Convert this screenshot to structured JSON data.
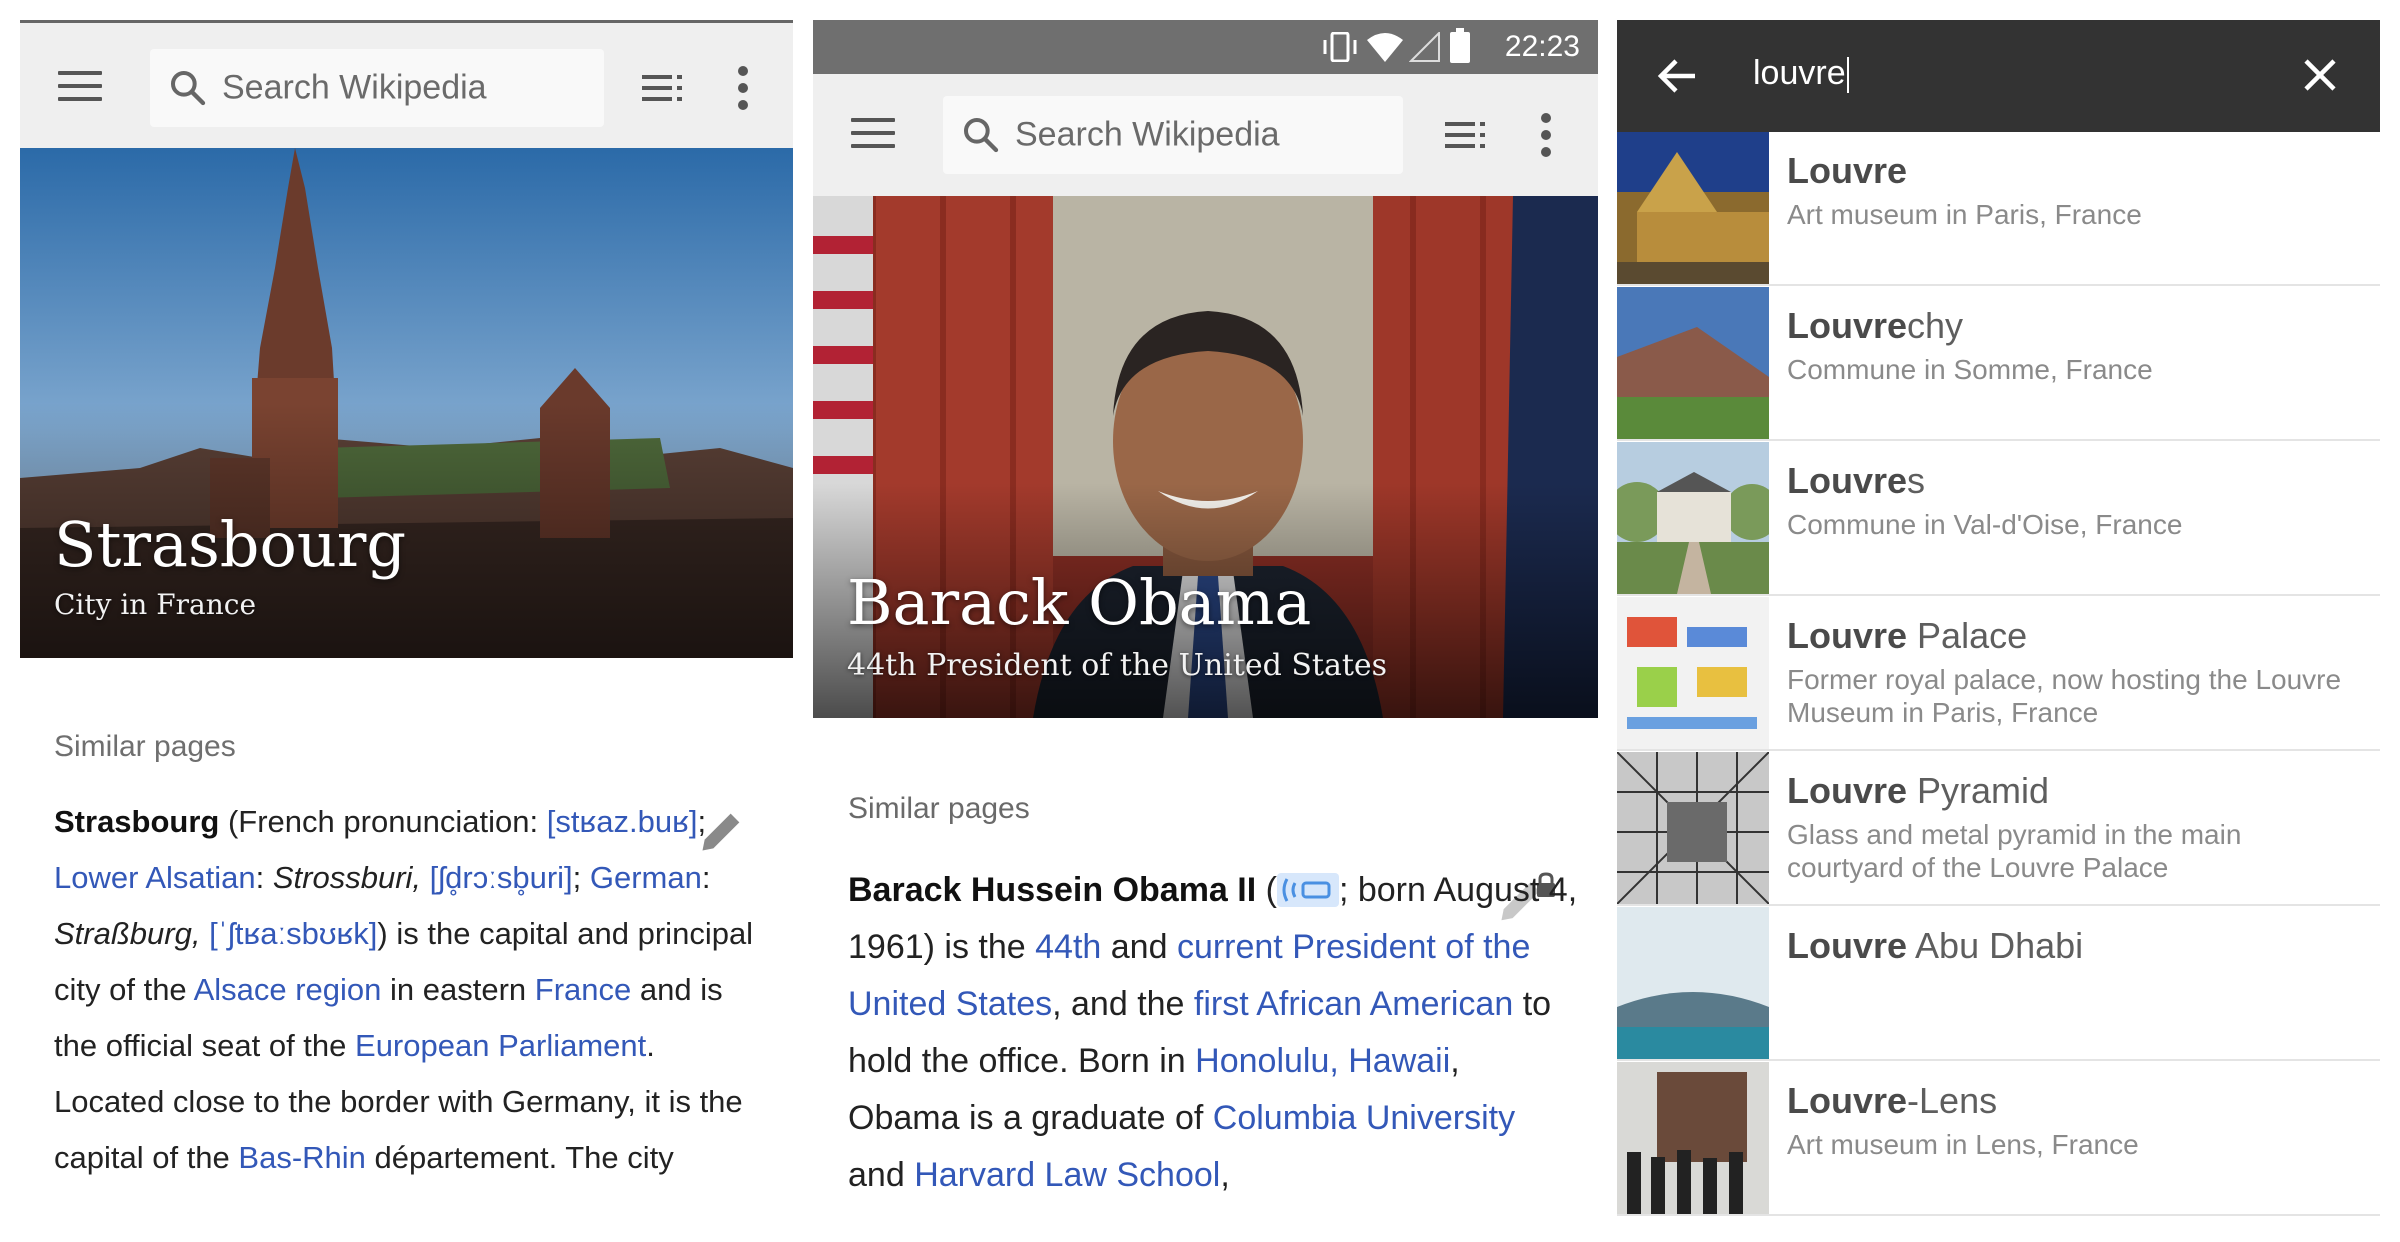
{
  "panel1": {
    "search_placeholder": "Search Wikipedia",
    "hero_title": "Strasbourg",
    "hero_subtitle": "City in France",
    "similar_pages": "Similar pages",
    "article": {
      "t1": "Strasbourg",
      "t2": " (French pronunciation: ",
      "t3": "[stʁaz.buʁ]",
      "t4": "; ",
      "t5": "Lower Alsatian",
      "t6": ": ",
      "t7": "Strossburi,",
      "t8": " ",
      "t9": "[ʃd̥rɔːsb̥uri]",
      "t10": "; ",
      "t11": "German",
      "t12": ": ",
      "t13": "Straßburg,",
      "t14": " ",
      "t15": "[ˈʃtʁaːsbʊʁk]",
      "t16": ") is the capital and principal city of the ",
      "t17": "Alsace region",
      "t18": " in eastern ",
      "t19": "France",
      "t20": " and is the official seat of the ",
      "t21": "European Parliament",
      "t22": ". Located close to the border with Germany, it is the capital of the ",
      "t23": "Bas-Rhin",
      "t24": " département. The city"
    }
  },
  "panel2": {
    "status_time": "22:23",
    "search_placeholder": "Search Wikipedia",
    "hero_title": "Barack Obama",
    "hero_subtitle": "44th President of the United States",
    "similar_pages": "Similar pages",
    "article": {
      "t1": "Barack Hussein Obama II",
      "t2": " (",
      "t3": "; born August 4, 1961) is the ",
      "t4": "44th",
      "t5": " and ",
      "t6": "current President of the United States",
      "t7": ", and the ",
      "t8": "first African American",
      "t9": " to hold the office. Born in ",
      "t10": "Honolulu, Hawaii",
      "t11": ", Obama is a graduate of ",
      "t12": "Columbia University",
      "t13": " and ",
      "t14": "Harvard Law School",
      "t15": ","
    }
  },
  "panel3": {
    "query": "louvre",
    "results": [
      {
        "match": "Louvre",
        "rest": "",
        "desc": "Art museum in Paris, France"
      },
      {
        "match": "Louvre",
        "rest": "chy",
        "desc": "Commune in Somme, France"
      },
      {
        "match": "Louvre",
        "rest": "s",
        "desc": "Commune in Val-d'Oise, France"
      },
      {
        "match": "Louvre",
        "rest": " Palace",
        "desc": "Former royal palace, now hosting the Louvre Museum in Paris, France"
      },
      {
        "match": "Louvre",
        "rest": " Pyramid",
        "desc": "Glass and metal pyramid in the main courtyard of the Louvre Palace"
      },
      {
        "match": "Louvre",
        "rest": " Abu Dhabi",
        "desc": ""
      },
      {
        "match": "Louvre",
        "rest": "-Lens",
        "desc": "Art museum in Lens, France"
      }
    ]
  },
  "colors": {
    "link": "#3358b8",
    "toolbar": "#efefef",
    "search_header": "#333333",
    "status_bar": "#6f6f6f"
  },
  "icons": [
    "menu-icon",
    "search-icon",
    "toc-icon",
    "more-icon",
    "edit-icon",
    "vibrate-icon",
    "wifi-icon",
    "signal-icon",
    "battery-icon",
    "back-arrow-icon",
    "close-icon",
    "audio-icon",
    "lock-icon"
  ]
}
